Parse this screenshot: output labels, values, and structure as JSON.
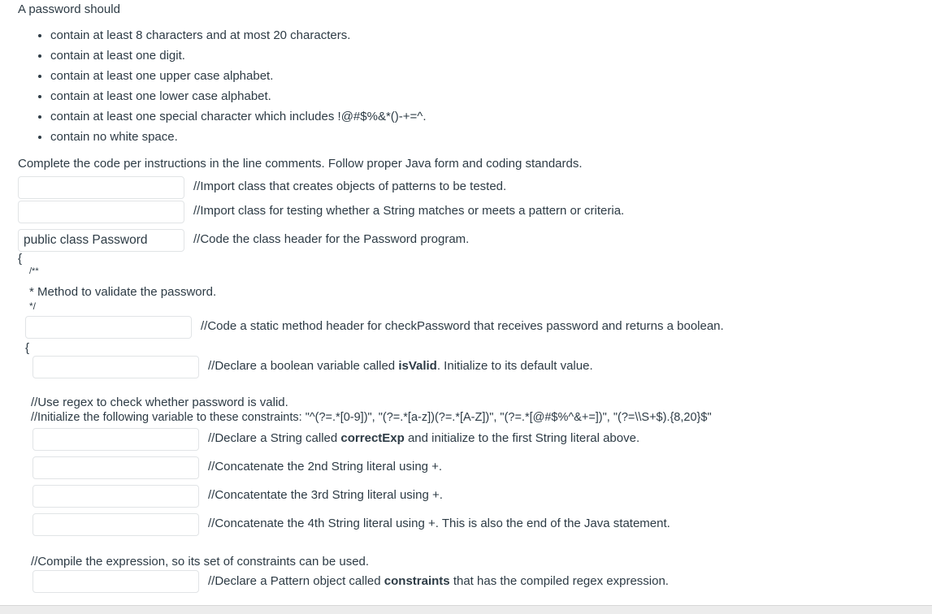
{
  "question": {
    "intro": "A password should",
    "rules": [
      "contain at least 8 characters and at most 20 characters.",
      "contain at least one digit.",
      "contain at least one upper case alphabet.",
      "contain at least one lower case alphabet.",
      "contain at least one special character which includes !@#$%&*()-+=^.",
      "contain no white space."
    ],
    "instructions": "Complete the code per instructions in the line comments.  Follow proper Java form and coding standards."
  },
  "code": {
    "blank1": {
      "value": "",
      "comment": "//Import class that creates objects of patterns to be tested."
    },
    "blank2": {
      "value": "",
      "comment": "//Import class for testing whether a String matches or meets a pattern or criteria."
    },
    "blank3": {
      "value": "public class Password",
      "comment": "//Code the class header for the Password program."
    },
    "open_brace_class": "{",
    "javadoc_open": "/**",
    "javadoc_body": "* Method to validate the password.",
    "javadoc_close": "*/",
    "blank4": {
      "value": "",
      "comment": "//Code a static method header for checkPassword that receives password and returns a boolean."
    },
    "open_brace_method": "{",
    "blank5": {
      "value": "",
      "comment_pre": "//Declare a boolean variable called ",
      "comment_bold": "isValid",
      "comment_post": ".  Initialize to its default value."
    },
    "regex_comment1": "//Use regex to check whether password is valid.",
    "regex_comment2": "//Initialize the following variable to these constraints:  \"^(?=.*[0-9])\", \"(?=.*[a-z])(?=.*[A-Z])\", \"(?=.*[@#$%^&+=])\", \"(?=\\\\S+$).{8,20}$\"",
    "blank6": {
      "value": "",
      "comment_pre": "//Declare a String called ",
      "comment_bold": "correctExp",
      "comment_post": " and initialize to the first String literal above."
    },
    "blank7": {
      "value": "",
      "comment": "//Concatenate the 2nd String literal using +."
    },
    "blank8": {
      "value": "",
      "comment": "//Concatentate the 3rd String literal using +."
    },
    "blank9": {
      "value": "",
      "comment": "//Concatenate the 4th String literal using +.  This is also the end of the Java statement."
    },
    "compile_comment": "//Compile the expression, so its set of constraints can be used.",
    "blank10": {
      "value": "",
      "comment_pre": "//Declare a Pattern object called ",
      "comment_bold": "constraints",
      "comment_post": " that has the compiled regex expression."
    }
  }
}
